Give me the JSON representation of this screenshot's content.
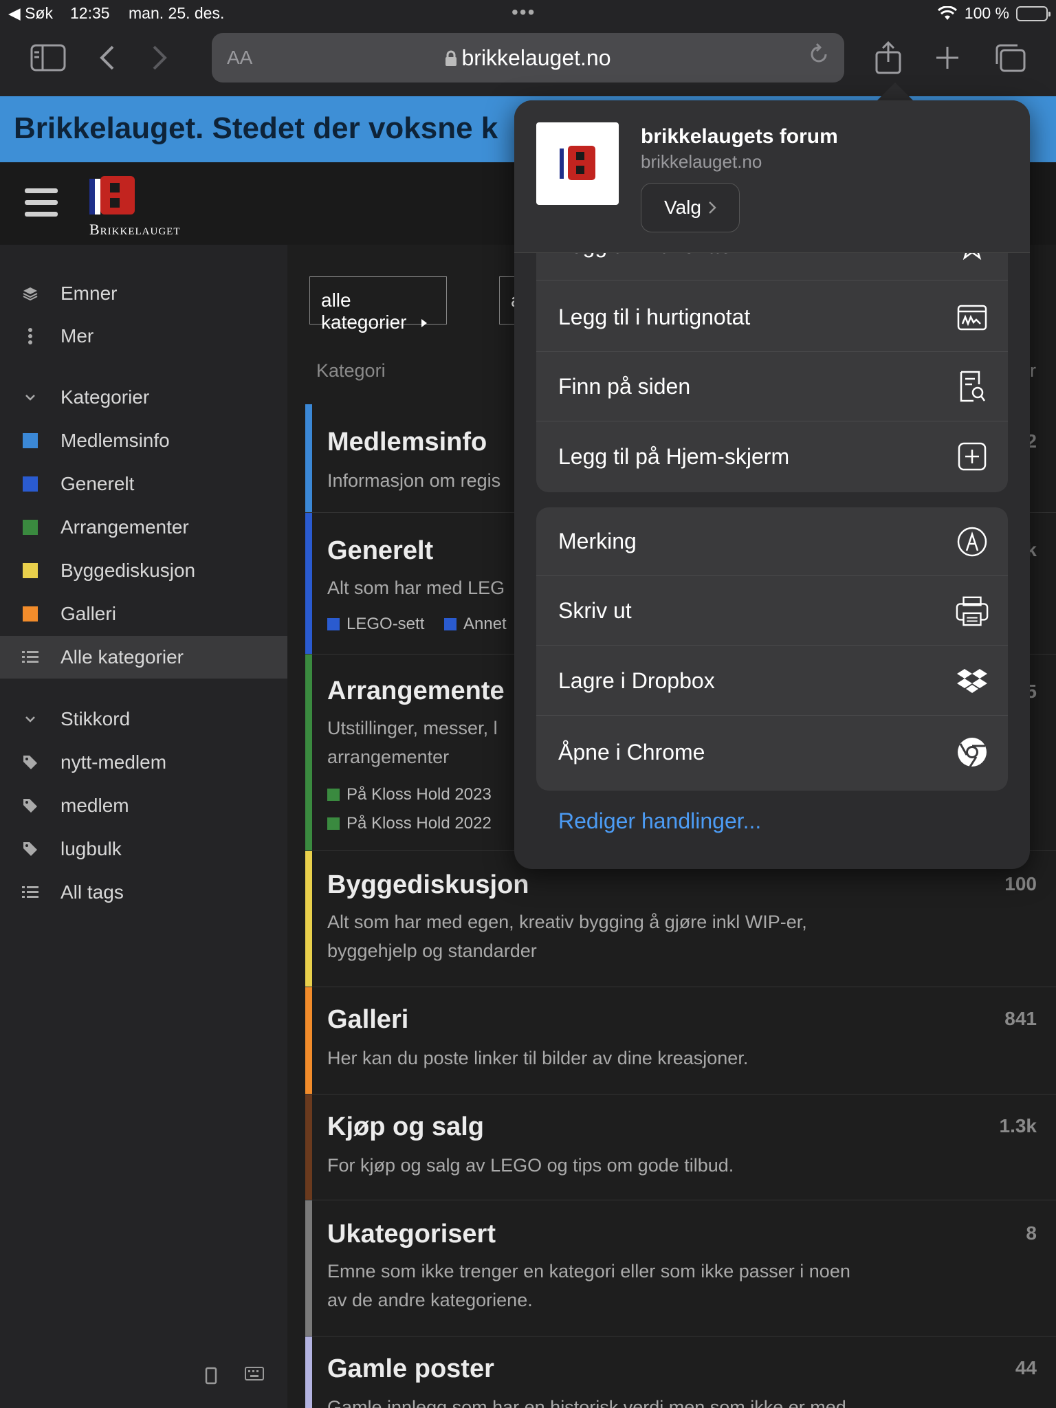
{
  "status": {
    "back_app": "◀ Søk",
    "time": "12:35",
    "date": "man. 25. des.",
    "battery": "100 %"
  },
  "browser": {
    "aa_label": "AA",
    "url": "brikkelauget.no"
  },
  "banner": {
    "text": "Brikkelauget. Stedet der voksne k"
  },
  "site": {
    "brand": "Brikkelauget"
  },
  "sidebar": {
    "nav": [
      {
        "label": "Emner"
      },
      {
        "label": "Mer"
      }
    ],
    "categories_heading": "Kategorier",
    "categories": [
      {
        "label": "Medlemsinfo",
        "color": "#3b88d6"
      },
      {
        "label": "Generelt",
        "color": "#2a5bd0"
      },
      {
        "label": "Arrangementer",
        "color": "#3a8a3f"
      },
      {
        "label": "Byggediskusjon",
        "color": "#e9d04c"
      },
      {
        "label": "Galleri",
        "color": "#f28c2b"
      }
    ],
    "all_categories": "Alle kategorier",
    "tags_heading": "Stikkord",
    "tags": [
      {
        "label": "nytt-medlem"
      },
      {
        "label": "medlem"
      },
      {
        "label": "lugbulk"
      }
    ],
    "all_tags": "All tags"
  },
  "main": {
    "filter_label": "alle kategorier",
    "filter2_label": "a",
    "col_category": "Kategori",
    "col_topics": "r",
    "cats": [
      {
        "title": "Medlemsinfo",
        "desc": "Informasjon om regis",
        "count": "2",
        "color": "#3b88d6"
      },
      {
        "title": "Generelt",
        "desc": "Alt som har med LEG",
        "count": "k",
        "color": "#2a5bd0",
        "subs": [
          "LEGO-sett",
          "Annet"
        ]
      },
      {
        "title": "Arrangemente",
        "desc": "Utstillinger, messer, l",
        "desc2": "arrangementer",
        "count": "5",
        "color": "#3a8a3f",
        "subs": [
          "På Kloss Hold 2023",
          "På Kloss Hold 2022"
        ]
      },
      {
        "title": "Byggediskusjon",
        "desc": "Alt som har med egen, kreativ bygging å gjøre inkl WIP-er,",
        "desc2": "byggehjelp og standarder",
        "count": "100",
        "color": "#e9d04c"
      },
      {
        "title": "Galleri",
        "desc": "Her kan du poste linker til bilder av dine kreasjoner.",
        "count": "841",
        "color": "#f28c2b"
      },
      {
        "title": "Kjøp og salg",
        "desc": "For kjøp og salg av LEGO og tips om gode tilbud.",
        "count": "1.3k",
        "color": "#6a3a1e"
      },
      {
        "title": "Ukategorisert",
        "desc": "Emne som ikke trenger en kategori eller som ikke passer i noen",
        "desc2": "av de andre kategoriene.",
        "count": "8",
        "color": "#7a7a7a"
      },
      {
        "title": "Gamle poster",
        "desc": "Gamle innlegg som har en historisk verdi men som ikke er med",
        "count": "44",
        "color": "#b3b3e0"
      }
    ]
  },
  "sheet": {
    "site_name": "brikkelaugets forum",
    "site_domain": "brikkelauget.no",
    "options_label": "Valg",
    "group1": [
      {
        "label": "Legg til i Favoritter",
        "icon": "star-icon"
      },
      {
        "label": "Legg til i hurtignotat",
        "icon": "quick-note-icon"
      },
      {
        "label": "Finn på siden",
        "icon": "find-on-page-icon"
      },
      {
        "label": "Legg til på Hjem-skjerm",
        "icon": "add-square-icon"
      }
    ],
    "group2": [
      {
        "label": "Merking",
        "icon": "markup-icon"
      },
      {
        "label": "Skriv ut",
        "icon": "printer-icon"
      },
      {
        "label": "Lagre i Dropbox",
        "icon": "dropbox-icon"
      },
      {
        "label": "Åpne i Chrome",
        "icon": "chrome-icon"
      }
    ],
    "edit_actions": "Rediger handlinger..."
  }
}
